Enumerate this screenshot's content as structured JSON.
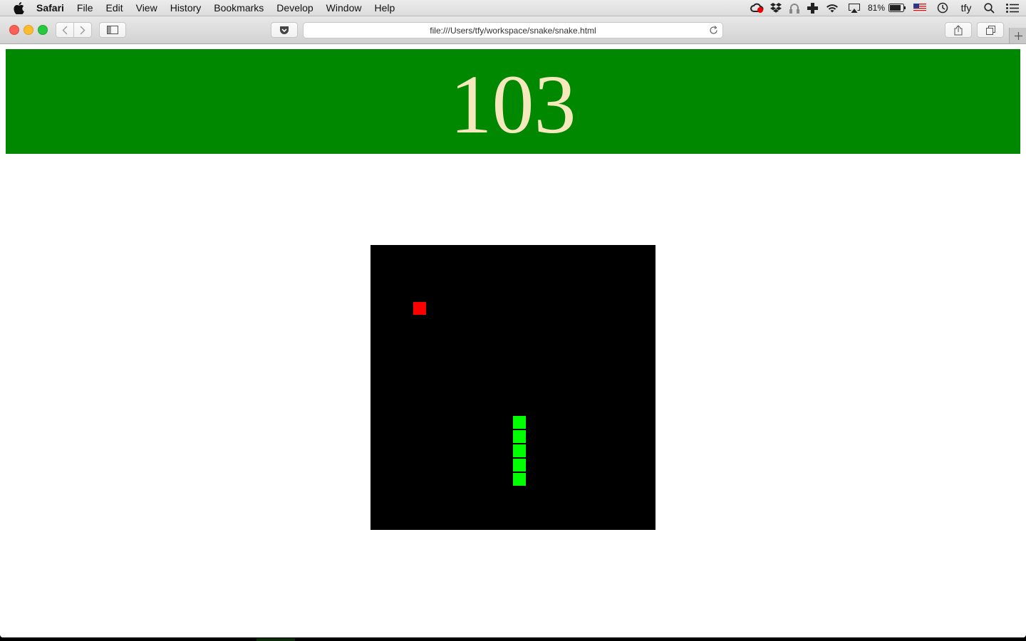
{
  "menubar": {
    "app": "Safari",
    "items": [
      "File",
      "Edit",
      "View",
      "History",
      "Bookmarks",
      "Develop",
      "Window",
      "Help"
    ],
    "battery_percent": "81%",
    "user": "tfy",
    "status_icons": [
      "creative-cloud-icon",
      "dropbox-icon",
      "headphones-icon",
      "plus-app-icon",
      "wifi-icon",
      "airplay-icon",
      "battery-icon",
      "us-flag-icon",
      "time-machine-icon",
      "spotlight-icon",
      "notification-center-icon"
    ]
  },
  "browser": {
    "url": "file:///Users/tfy/workspace/snake/snake.html"
  },
  "game": {
    "score": "103",
    "colors": {
      "banner": "#008800",
      "score_text": "#f6e8bd",
      "board": "#000000",
      "food": "#ff0000",
      "snake": "#00ff00"
    },
    "grid_size": 20,
    "food": {
      "col": 3,
      "row": 4
    },
    "snake": [
      {
        "col": 10,
        "row": 12
      },
      {
        "col": 10,
        "row": 13
      },
      {
        "col": 10,
        "row": 14
      },
      {
        "col": 10,
        "row": 15
      },
      {
        "col": 10,
        "row": 16
      }
    ]
  }
}
